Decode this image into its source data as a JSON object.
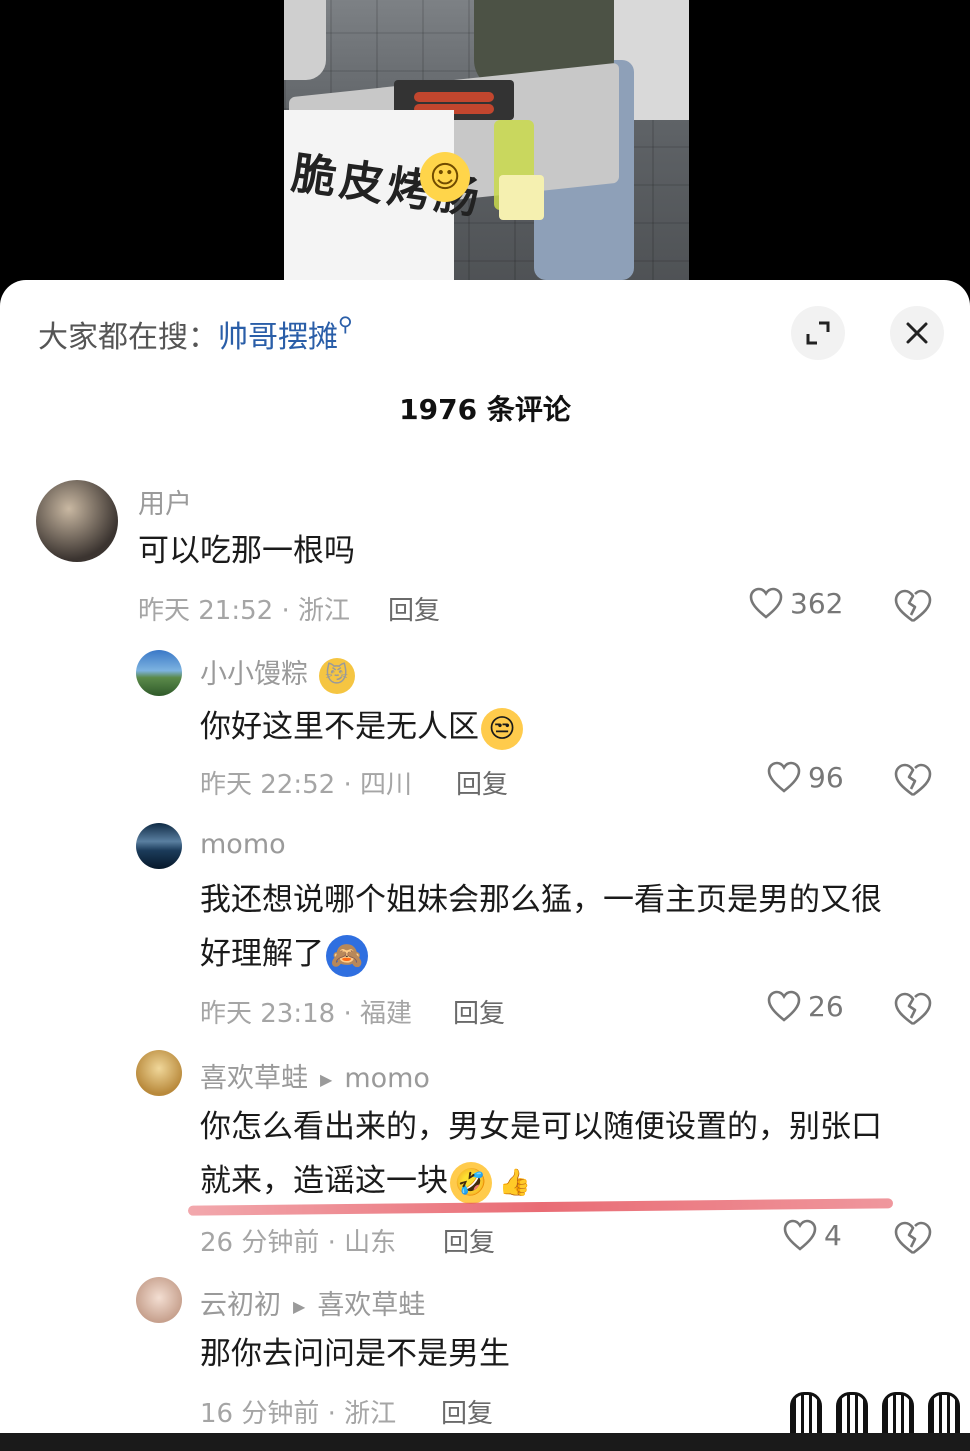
{
  "video": {
    "banner_text": "脆皮烤肠"
  },
  "header": {
    "search_label": "大家都在搜：",
    "search_term": "帅哥摆摊",
    "comment_count": "1976 条评论"
  },
  "comments": [
    {
      "user": "用户",
      "text": "可以吃那一根吗",
      "time": "昨天 21:52 · 浙江",
      "reply": "回复",
      "likes": "362"
    },
    {
      "user": "小小馒粽",
      "text": "你好这里不是无人区",
      "time": "昨天 22:52 · 四川",
      "reply": "回复",
      "likes": "96"
    },
    {
      "user": "momo",
      "text_line1": "我还想说哪个姐妹会那么猛，一看主页是男的又很",
      "text_line2": "好理解了",
      "time": "昨天 23:18 · 福建",
      "reply": "回复",
      "likes": "26"
    },
    {
      "user": "喜欢草蛙",
      "reply_to": "momo",
      "text_line1": "你怎么看出来的，男女是可以随便设置的，别张口",
      "text_line2": "就来，造谣这一块",
      "time": "26 分钟前 · 山东",
      "reply": "回复",
      "likes": "4"
    },
    {
      "user": "云初初",
      "reply_to": "喜欢草蛙",
      "text": "那你去问问是不是男生",
      "time": "16 分钟前 · 浙江",
      "reply": "回复"
    }
  ],
  "icons": {
    "expand": "expand-icon",
    "close": "close-icon",
    "heart": "heart-icon",
    "broken_heart": "broken-heart-icon",
    "search": "search-icon",
    "reply_arrow": "play-arrow-icon"
  },
  "colors": {
    "link": "#2a5ea8",
    "underline": "#e5525c",
    "muted": "#a5a5a5"
  }
}
